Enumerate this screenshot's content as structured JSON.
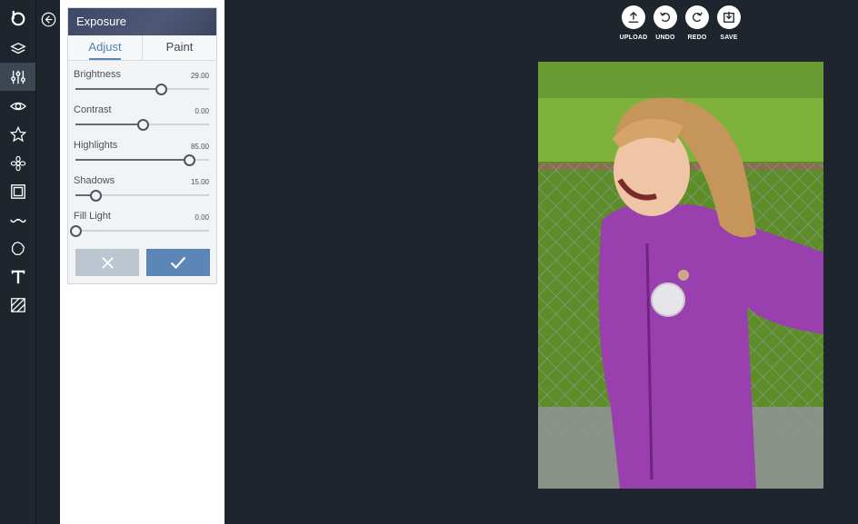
{
  "sidebar": {
    "tools": [
      {
        "name": "logo",
        "icon": "b-logo-icon"
      },
      {
        "name": "layers",
        "icon": "layers-icon"
      },
      {
        "name": "adjust",
        "icon": "sliders-icon",
        "active": true
      },
      {
        "name": "view",
        "icon": "eye-icon"
      },
      {
        "name": "favorites",
        "icon": "star-icon"
      },
      {
        "name": "effects",
        "icon": "flower-icon"
      },
      {
        "name": "frames",
        "icon": "frame-icon"
      },
      {
        "name": "touch-up",
        "icon": "mustache-icon"
      },
      {
        "name": "stickers",
        "icon": "badge-icon"
      },
      {
        "name": "text",
        "icon": "text-icon"
      },
      {
        "name": "textures",
        "icon": "texture-icon"
      }
    ]
  },
  "panel": {
    "title": "Exposure",
    "tabs": {
      "adjust": "Adjust",
      "paint": "Paint",
      "active": "adjust"
    },
    "sliders": [
      {
        "label": "Brightness",
        "value": "29.00",
        "fraction": 0.64
      },
      {
        "label": "Contrast",
        "value": "0.00",
        "fraction": 0.5
      },
      {
        "label": "Highlights",
        "value": "85.00",
        "fraction": 0.85
      },
      {
        "label": "Shadows",
        "value": "15.00",
        "fraction": 0.15
      },
      {
        "label": "Fill Light",
        "value": "0.00",
        "fraction": 0.0
      }
    ],
    "cancel_icon": "x-icon",
    "apply_icon": "check-icon"
  },
  "actions": {
    "upload": "UPLOAD",
    "undo": "UNDO",
    "redo": "REDO",
    "save": "SAVE"
  },
  "colors": {
    "background": "#1f252d",
    "accent": "#5b86b5",
    "cancel": "#bcc6d0",
    "header": "#3f4a66"
  }
}
